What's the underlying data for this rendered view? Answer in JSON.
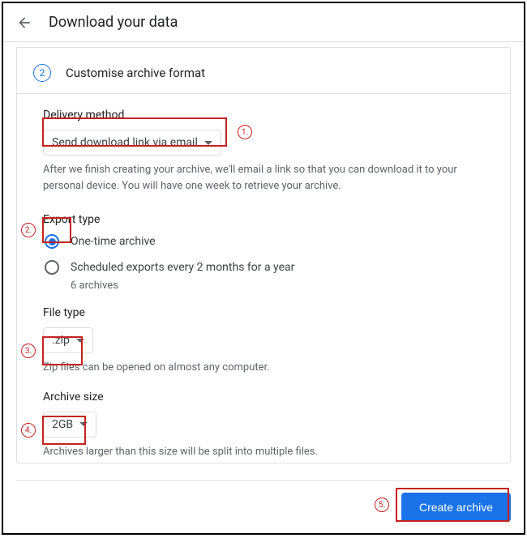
{
  "header": {
    "title": "Download your data"
  },
  "step": {
    "number": "2",
    "title": "Customise archive format"
  },
  "delivery": {
    "label": "Delivery method",
    "selected": "Send download link via email",
    "help": "After we finish creating your archive, we'll email a link so that you can download it to your personal device. You will have one week to retrieve your archive."
  },
  "export_type": {
    "label": "Export type",
    "options": [
      {
        "label": "One-time archive",
        "selected": true
      },
      {
        "label": "Scheduled exports every 2 months for a year",
        "selected": false,
        "sub": "6 archives"
      }
    ]
  },
  "file_type": {
    "label": "File type",
    "selected": ".zip",
    "help": "Zip files can be opened on almost any computer."
  },
  "archive_size": {
    "label": "Archive size",
    "selected": "2GB",
    "help": "Archives larger than this size will be split into multiple files."
  },
  "footer": {
    "button": "Create archive"
  },
  "annotations": {
    "1": "1.",
    "2": "2.",
    "3": "3.",
    "4": "4.",
    "5": "5."
  }
}
